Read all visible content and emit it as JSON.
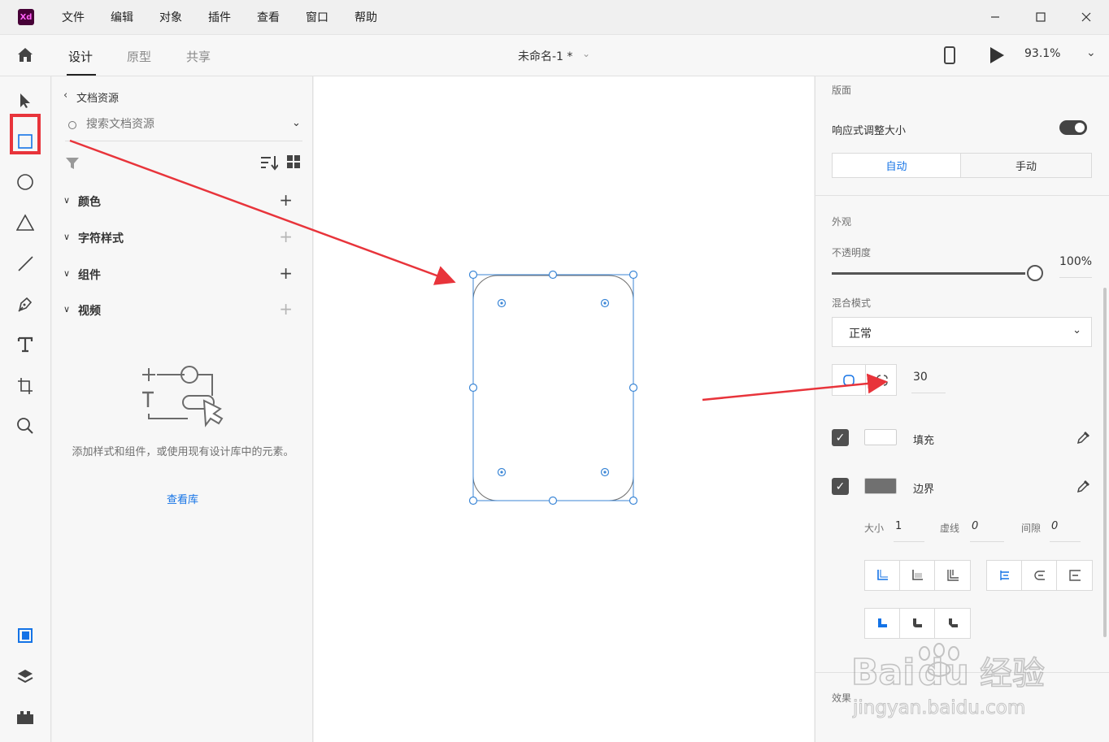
{
  "app": {
    "logo_text": "Xd",
    "menu": [
      "文件",
      "编辑",
      "对象",
      "插件",
      "查看",
      "窗口",
      "帮助"
    ],
    "window_controls": [
      "minimize",
      "maximize",
      "close"
    ]
  },
  "toolbar": {
    "tabs": [
      "设计",
      "原型",
      "共享"
    ],
    "active_tab": "设计",
    "document_title": "未命名-1 *",
    "zoom": "93.1%"
  },
  "tools": [
    "select-tool",
    "rectangle-tool",
    "ellipse-tool",
    "polygon-tool",
    "line-tool",
    "pen-tool",
    "text-tool",
    "artboard-tool",
    "zoom-tool",
    "assets-panel",
    "layers-panel",
    "plugins-panel"
  ],
  "assets": {
    "back_label": "文档资源",
    "search_placeholder": "搜索文档资源",
    "sections": [
      {
        "label": "颜色",
        "plus_enabled": true
      },
      {
        "label": "字符样式",
        "plus_enabled": false
      },
      {
        "label": "组件",
        "plus_enabled": true
      },
      {
        "label": "视频",
        "plus_enabled": false
      }
    ],
    "empty_text": "添加样式和组件，或使用现有设计库中的元素。",
    "view_library": "查看库"
  },
  "properties": {
    "layout_title": "版面",
    "responsive_label": "响应式调整大小",
    "responsive_on": true,
    "resize_auto": "自动",
    "resize_manual": "手动",
    "appearance_title": "外观",
    "opacity_label": "不透明度",
    "opacity_value": "100%",
    "opacity_level": 1.0,
    "blend_label": "混合模式",
    "blend_value": "正常",
    "corner_radius": "30",
    "fill_label": "填充",
    "fill_color": "#ffffff",
    "border_label": "边界",
    "border_color": "#707070",
    "stroke_size_label": "大小",
    "stroke_size": "1",
    "dash_label": "虚线",
    "dash_value": "0",
    "gap_label": "间隙",
    "gap_value": "0",
    "effects_title": "效果"
  },
  "colors": {
    "accent": "#1473e6",
    "annotation": "#e8343b",
    "selection": "#3b86d6"
  },
  "watermark": {
    "brand": "Bai",
    "brand2": "du",
    "cn": "经验",
    "url": "jingyan.baidu.com"
  }
}
